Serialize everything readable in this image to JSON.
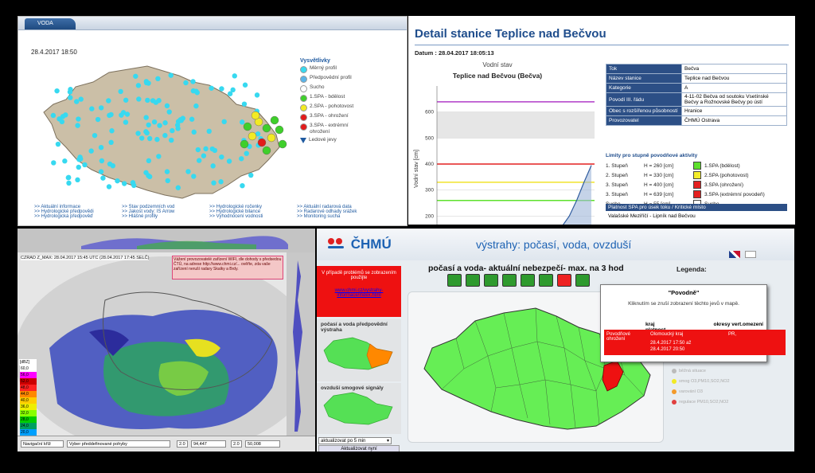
{
  "water_map": {
    "tab": "VODA",
    "date": "28.4.2017 18:50",
    "legend_title": "Vysvětlivky",
    "legend": [
      {
        "label": "Měrný profil",
        "color": "#37d9f0"
      },
      {
        "label": "Předpovědní profil",
        "color": "#5ab4e8"
      },
      {
        "label": "Sucho",
        "color": "#ffffff"
      },
      {
        "label": "1.SPA - bdělost",
        "color": "#3fcf2b"
      },
      {
        "label": "2.SPA - pohotovost",
        "color": "#f2ea24"
      },
      {
        "label": "3.SPA - ohrožení",
        "color": "#e21b1b"
      },
      {
        "label": "3.SPA - extrémní ohrožení",
        "color": "#e21b1b"
      },
      {
        "label": "Ledové jevy",
        "color": "#1f5aa0"
      }
    ],
    "links": [
      ">> Aktuální informace",
      ">> Stav podzemních vod",
      ">> Hydrologické ročenky",
      ">> Aktuální radarová data",
      ">> Hydrologické předpovědi",
      ">> Jakost vody: IS Arrow",
      ">> Hydrologické bilance",
      ">> Radarové odhady srážek",
      ">> Hydrologická předpověď",
      ">> Hlášné profily",
      ">> Vyhodnocení vodnosti",
      ">> Monitoring sucha"
    ]
  },
  "station": {
    "title": "Detail stanice Teplice nad Bečvou",
    "date": "Datum : 28.04.2017 18:05:13",
    "chart_title": "Vodní stav",
    "chart_subtitle": "Teplice nad Bečvou (Bečva)",
    "table": [
      {
        "k": "Tok",
        "v": "Bečva"
      },
      {
        "k": "Název stanice",
        "v": "Teplice nad Bečvou"
      },
      {
        "k": "Kategorie",
        "v": "A"
      },
      {
        "k": "Povodí III. řádu",
        "v": "4-11-02 Bečva od soutoku Vsetínské Bečvy a Rožnovské Bečvy po ústí"
      },
      {
        "k": "Obec s rozšířenou působností",
        "v": "Hranice"
      },
      {
        "k": "Provozovatel",
        "v": "ČHMÚ Ostrava"
      }
    ],
    "limits_title": "Limity pro stupně povodňové aktivity",
    "limits": [
      {
        "stage": "1. Stupeň",
        "h": "H = 260 [cm]",
        "label": "1.SPA (bdělost)",
        "color": "#5ee02c"
      },
      {
        "stage": "2. Stupeň",
        "h": "H = 330 [cm]",
        "label": "2.SPA (pohotovost)",
        "color": "#f3ec2a"
      },
      {
        "stage": "3. Stupeň",
        "h": "H = 400 [cm]",
        "label": "3.SPA (ohrožení)",
        "color": "#e42020"
      },
      {
        "stage": "3. Stupeň",
        "h": "H = 639 [cm]",
        "label": "3.SPA (extrémní povodeň)",
        "color": "#e42020"
      },
      {
        "stage": "Sucho",
        "h": "H = 55 [cm]",
        "label": "Sucho",
        "color": "#ffffff"
      }
    ],
    "spa_header": "Platnost SPA pro úsek toku / Kritické místo",
    "spa_text": "Valašské Meziříčí - Lipník nad Bečvou"
  },
  "chart_data": {
    "type": "line",
    "title": "Vodní stav",
    "subtitle": "Teplice nad Bečvou (Bečva)",
    "ylabel": "Vodní stav [cm]",
    "xlabel": "",
    "ylim": [
      100,
      700
    ],
    "yticks": [
      100,
      200,
      300,
      400,
      500,
      600
    ],
    "thresholds": [
      {
        "name": "3.SPA (extrémní povodeň)",
        "value": 639,
        "color": "#b03cc8"
      },
      {
        "name": "3.SPA (ohrožení)",
        "value": 400,
        "color": "#e42020"
      },
      {
        "name": "2.SPA (pohotovost)",
        "value": 330,
        "color": "#f0e22a"
      },
      {
        "name": "1.SPA (bdělost)",
        "value": 260,
        "color": "#5ee02c"
      }
    ],
    "series": [
      {
        "values": [
          108,
          108,
          109,
          109,
          110,
          110,
          111,
          111,
          112,
          112,
          113,
          114,
          115,
          118,
          122,
          128,
          138,
          160,
          200,
          260,
          330,
          395
        ]
      }
    ]
  },
  "radar": {
    "header": "CZRAD Z_MAX: 28.04.2017 15:45 UTC (28.04.2017 17:45 SELČ)",
    "notice": "Vážení provozovatelé zařízení WIFI, dle dohody s předsedou ČTÚ, na adrese http://www.chmi.cz/... ověřte, zda vaše zařízení neruší radary Skalky a Brdy.",
    "scale_title": "[dBZ]",
    "scale": [
      "60,0",
      "56,0",
      "52,0",
      "48,0",
      "44,0",
      "40,0",
      "36,0",
      "32,0",
      "28,0",
      "24,0",
      "20,0",
      "16,0",
      "12,0",
      "8,0",
      "4,0"
    ],
    "scale_colors": [
      "#ffffff",
      "#ff00ff",
      "#cc0000",
      "#ff2222",
      "#ff8800",
      "#ffcc00",
      "#eeee00",
      "#88ff00",
      "#00cc00",
      "#00a060",
      "#00a0ff",
      "#0066ff",
      "#2222cc",
      "#3300aa",
      "#38006c"
    ],
    "nav_label": "Navigační kříž",
    "select_label": "Vyber předdefinované pohyby",
    "field1": "2.0",
    "field2": "94,447",
    "field3": "2.0",
    "field4": "50,008"
  },
  "warnings": {
    "logo": "ČHMÚ",
    "slogan": "výstrahy: počasí, voda, ovzduší",
    "red_box_title": "V případě problémů se zobrazením použijte",
    "red_box_link": "www.chmi.cz/vystrahy-informace/index.html",
    "side1": "počasí a voda předpovědní výstraha",
    "side2": "ovzduší smogové signály",
    "map_title": "počasí a voda- aktuální nebezpečí- max. na 3 hod",
    "legenda": "Legenda:",
    "popup_title": "\"Povodně\"",
    "popup_text": "Kliknutím se zruší zobrazení těchto jevů v mapě.",
    "col_kraj": "kraj",
    "col_platnost": "platnost",
    "col_okresy": "okresy",
    "col_vert": "vert.omezení",
    "row_type": "Povodňové ohrožení",
    "row_kraj": "Olomoucký kraj",
    "row_from": "28.4.2017 17:50 až",
    "row_to": "28.4.2017 20:50",
    "row_okres": "PR,",
    "legend_list": [
      "běžná situace",
      "smog O3,PM10,SO2,NO2",
      "varování O3",
      "regulace PM10,SO2,NO2"
    ],
    "select": "aktualizovat po 5 min",
    "button": "Aktualizovat nyní"
  }
}
